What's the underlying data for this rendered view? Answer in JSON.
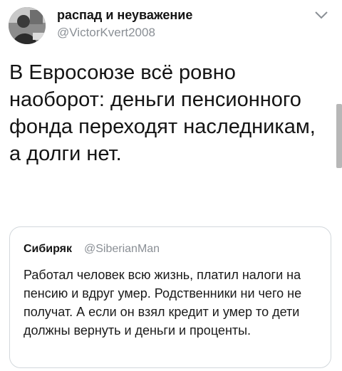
{
  "tweet": {
    "author": {
      "display_name": "распад и неуважение",
      "handle": "@VictorKvert2008",
      "avatar_icon": "user-photo-avatar"
    },
    "menu_icon": "chevron-down-icon",
    "text": "В Евросоюзе всё ровно наоборот: деньги пенсионного фонда переходят наследникам, а долги нет.",
    "quoted": {
      "display_name": "Сибиряк",
      "handle": "@SiberianMan",
      "text": "Работал человек всю жизнь, платил налоги на пенсию и вдруг умер. Родственники ни чего не получат.  А если он взял кредит и умер то дети должны вернуть и деньги и проценты."
    }
  },
  "colors": {
    "text_primary": "#141414",
    "text_secondary": "#8a8f95",
    "card_border": "#d3d8dc",
    "background": "#ffffff"
  }
}
